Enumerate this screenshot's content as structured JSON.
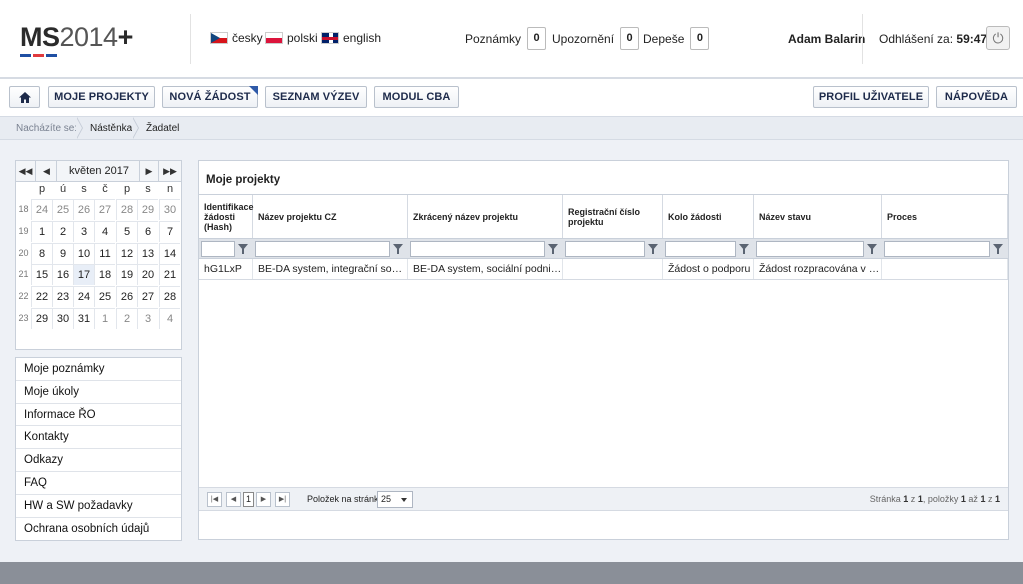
{
  "header": {
    "logo": {
      "bold": "MS",
      "light": "2014",
      "plus": "+"
    },
    "logo_bar_colors": [
      "#1f4fa3",
      "#e03a3e",
      "#1f4fa3"
    ],
    "languages": [
      {
        "label": "česky",
        "icon": "czech-flag-icon"
      },
      {
        "label": "polski",
        "icon": "polish-flag-icon"
      },
      {
        "label": "english",
        "icon": "uk-flag-icon"
      }
    ],
    "counters": [
      {
        "label": "Poznámky",
        "value": "0"
      },
      {
        "label": "Upozornění",
        "value": "0"
      },
      {
        "label": "Depeše",
        "value": "0"
      }
    ],
    "user_name": "Adam Balarin",
    "logout_label": "Odhlášení za:",
    "logout_time": "59:47",
    "power_icon": "power-icon"
  },
  "nav": {
    "home_icon": "home-icon",
    "buttons": [
      "MOJE PROJEKTY",
      "NOVÁ ŽÁDOST",
      "SEZNAM VÝZEV",
      "MODUL CBA"
    ],
    "right_buttons": [
      "PROFIL UŽIVATELE",
      "NÁPOVĚDA"
    ]
  },
  "breadcrumb": {
    "prefix": "Nacházíte se:",
    "items": [
      "Nástěnka",
      "Žadatel"
    ]
  },
  "calendar": {
    "title": "květen 2017",
    "days_of_week": [
      "p",
      "ú",
      "s",
      "č",
      "p",
      "s",
      "n"
    ],
    "weeks": [
      {
        "wk": "18",
        "days": [
          "24",
          "25",
          "26",
          "27",
          "28",
          "29",
          "30"
        ]
      },
      {
        "wk": "19",
        "days": [
          "1",
          "2",
          "3",
          "4",
          "5",
          "6",
          "7"
        ]
      },
      {
        "wk": "20",
        "days": [
          "8",
          "9",
          "10",
          "11",
          "12",
          "13",
          "14"
        ]
      },
      {
        "wk": "21",
        "days": [
          "15",
          "16",
          "17",
          "18",
          "19",
          "20",
          "21"
        ]
      },
      {
        "wk": "22",
        "days": [
          "22",
          "23",
          "24",
          "25",
          "26",
          "27",
          "28"
        ]
      },
      {
        "wk": "23",
        "days": [
          "29",
          "30",
          "31",
          "1",
          "2",
          "3",
          "4"
        ]
      }
    ],
    "today": "17"
  },
  "side_menu": [
    "Moje poznámky",
    "Moje úkoly",
    "Informace ŘO",
    "Kontakty",
    "Odkazy",
    "FAQ",
    "HW a SW požadavky",
    "Ochrana osobních údajů"
  ],
  "projects": {
    "title": "Moje projekty",
    "columns": [
      "Identifikace žádosti (Hash)",
      "Název projektu CZ",
      "Zkrácený název projektu",
      "Registrační číslo projektu",
      "Kolo žádosti",
      "Název stavu",
      "Proces"
    ],
    "rows": [
      [
        "hG1LxP",
        "BE-DA system, integrační sociáln...",
        "BE-DA system, sociální podnikání",
        "",
        "Žádost o podporu",
        "Žádost rozpracována v ISKP",
        ""
      ]
    ],
    "pager": {
      "current_page": "1",
      "per_page_label": "Položek na stránku",
      "per_page": "25",
      "info_prefix": "Stránka",
      "info_page": "1",
      "info_of": "z",
      "info_pages": "1",
      "info_items": ", položky",
      "info_from": "1",
      "info_to_word": "až",
      "info_to": "1",
      "info_total": "1"
    }
  }
}
